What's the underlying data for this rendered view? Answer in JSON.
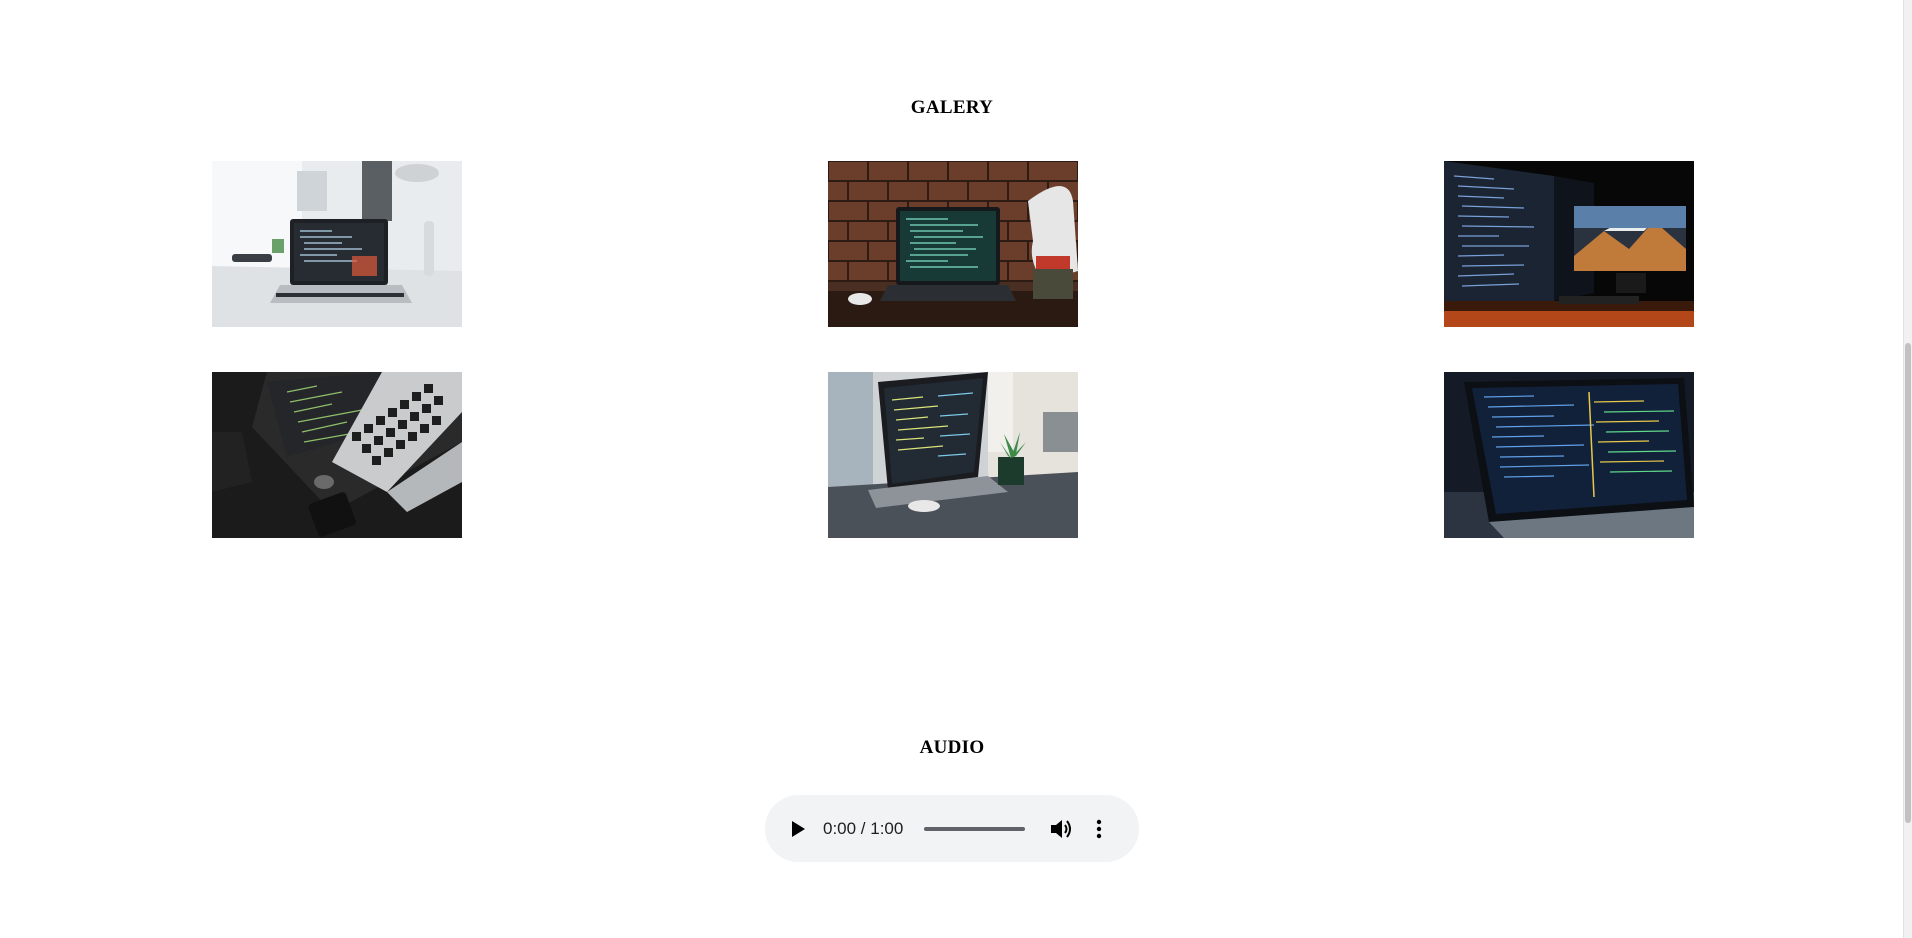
{
  "gallery": {
    "title": "GALERY",
    "images": [
      {
        "name": "photo-laptop-white-desk",
        "scene": "laptop on bright white desk"
      },
      {
        "name": "photo-laptop-brick-wall",
        "scene": "laptop against brick wall with sneaker"
      },
      {
        "name": "photo-dual-monitors-dark",
        "scene": "dual monitors in dark room"
      },
      {
        "name": "photo-macbook-dark-desk",
        "scene": "macbook on dark desk from above"
      },
      {
        "name": "photo-laptop-plant-window",
        "scene": "laptop with plant by window"
      },
      {
        "name": "photo-laptop-dark-code",
        "scene": "laptop showing code in the dark"
      }
    ]
  },
  "audio": {
    "title": "AUDIO",
    "time_display": "0:00 / 1:00",
    "progress": 0,
    "icons": {
      "play": "play-icon",
      "volume": "volume-icon",
      "menu": "more-vert-icon"
    }
  }
}
